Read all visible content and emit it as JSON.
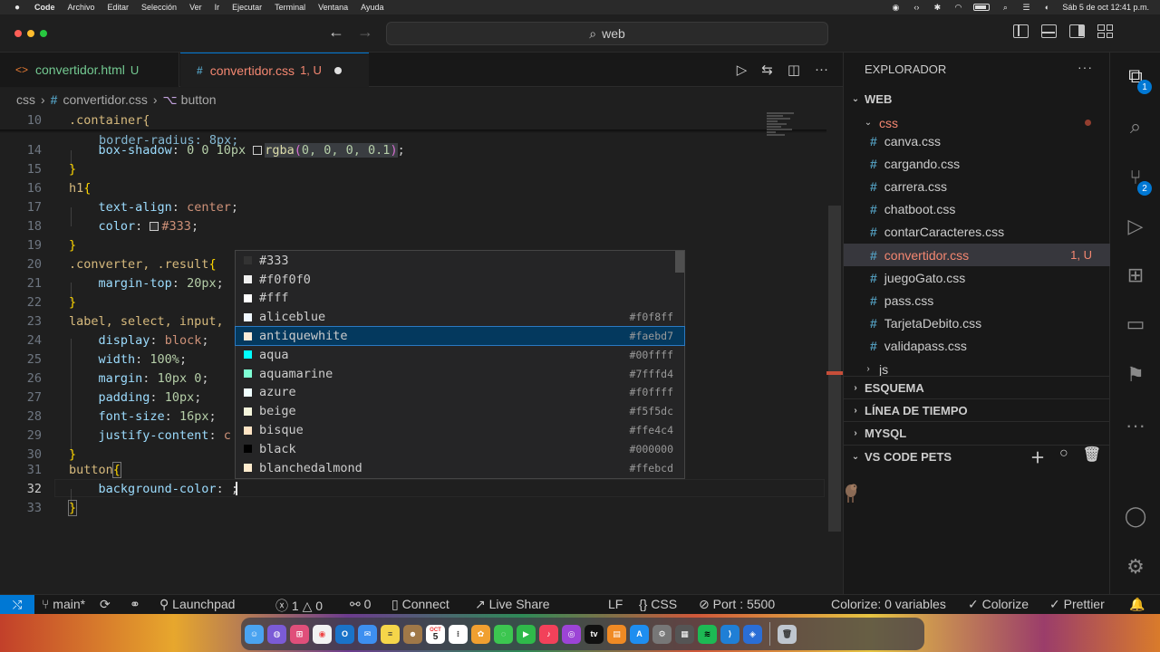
{
  "menubar": {
    "app": "Code",
    "items": [
      "Archivo",
      "Editar",
      "Selección",
      "Ver",
      "Ir",
      "Ejecutar",
      "Terminal",
      "Ventana",
      "Ayuda"
    ],
    "datetime": "Sáb 5 de oct  12:41 p.m."
  },
  "titlebar": {
    "search": "web"
  },
  "tabs": [
    {
      "name": "convertidor.html",
      "badge": "U"
    },
    {
      "name": "convertidor.css",
      "badge": "1, U"
    }
  ],
  "breadcrumb": {
    "folder": "css",
    "file": "convertidor.css",
    "symbol": "button"
  },
  "editor": {
    "line_numbers": [
      "10",
      "14",
      "15",
      "16",
      "17",
      "18",
      "19",
      "20",
      "21",
      "22",
      "23",
      "24",
      "25",
      "26",
      "27",
      "28",
      "29",
      "30",
      "31",
      "32",
      "33"
    ],
    "sticky_line": ".container{",
    "partial_line": "border-radius: 8px;"
  },
  "suggestions": [
    {
      "label": "#333",
      "hex": "",
      "color": "#333333"
    },
    {
      "label": "#f0f0f0",
      "hex": "",
      "color": "#f0f0f0"
    },
    {
      "label": "#fff",
      "hex": "",
      "color": "#ffffff"
    },
    {
      "label": "aliceblue",
      "hex": "#f0f8ff",
      "color": "#f0f8ff"
    },
    {
      "label": "antiquewhite",
      "hex": "#faebd7",
      "color": "#faebd7"
    },
    {
      "label": "aqua",
      "hex": "#00ffff",
      "color": "#00ffff"
    },
    {
      "label": "aquamarine",
      "hex": "#7fffd4",
      "color": "#7fffd4"
    },
    {
      "label": "azure",
      "hex": "#f0ffff",
      "color": "#f0ffff"
    },
    {
      "label": "beige",
      "hex": "#f5f5dc",
      "color": "#f5f5dc"
    },
    {
      "label": "bisque",
      "hex": "#ffe4c4",
      "color": "#ffe4c4"
    },
    {
      "label": "black",
      "hex": "#000000",
      "color": "#000000"
    },
    {
      "label": "blanchedalmond",
      "hex": "#ffebcd",
      "color": "#ffebcd"
    }
  ],
  "explorer": {
    "title": "EXPLORADOR",
    "root": "WEB",
    "folder": "css",
    "files": [
      "canva.css",
      "cargando.css",
      "carrera.css",
      "chatboot.css",
      "contarCaracteres.css",
      "convertidor.css",
      "juegoGato.css",
      "pass.css",
      "TarjetaDebito.css",
      "validapass.css"
    ],
    "active_file_badge": "1, U",
    "subfolder": "js",
    "sections": [
      "ESQUEMA",
      "LÍNEA DE TIEMPO",
      "MYSQL",
      "VS CODE PETS"
    ]
  },
  "activity": {
    "explorer_badge": "1",
    "scm_badge": "2"
  },
  "statusbar": {
    "branch": "main*",
    "launchpad": "Launchpad",
    "errors": "1",
    "warnings": "0",
    "ports_count": "0",
    "connect": "Connect",
    "live_share": "Live Share",
    "eol": "LF",
    "language": "CSS",
    "port": "Port : 5500",
    "colorize_vars": "Colorize: 0 variables",
    "colorize": "Colorize",
    "prettier": "Prettier"
  },
  "dock": {
    "calendar_day": "5",
    "calendar_month": "OCT"
  }
}
